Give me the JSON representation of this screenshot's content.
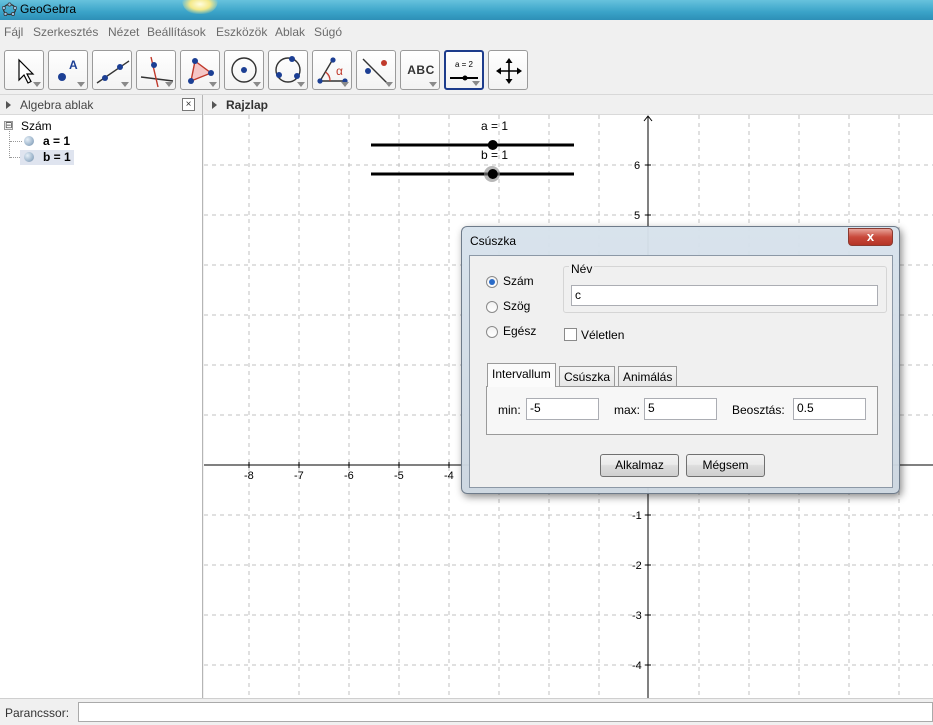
{
  "window": {
    "title": "GeoGebra"
  },
  "menu": [
    "Fájl",
    "Szerkesztés",
    "Nézet",
    "Beállítások",
    "Eszközök",
    "Ablak",
    "Súgó"
  ],
  "toolbar": {
    "tools": [
      {
        "icon": "move-arrow-icon"
      },
      {
        "icon": "new-point-icon",
        "label": "A"
      },
      {
        "icon": "line-through-two-points-icon"
      },
      {
        "icon": "perpendicular-line-icon"
      },
      {
        "icon": "polygon-icon"
      },
      {
        "icon": "circle-center-point-icon"
      },
      {
        "icon": "circle-three-points-icon"
      },
      {
        "icon": "angle-icon",
        "label": "α"
      },
      {
        "icon": "reflect-about-line-icon"
      },
      {
        "icon": "insert-text-icon",
        "label": "ABC"
      },
      {
        "icon": "slider-icon",
        "label": "a = 2"
      },
      {
        "icon": "move-graphics-view-icon"
      }
    ],
    "selected_index": 10
  },
  "algebra": {
    "title": "Algebra ablak",
    "close_label": "×",
    "group": "Szám",
    "toggle": "⊟",
    "objects": [
      "a = 1",
      "b = 1"
    ]
  },
  "graphics": {
    "title": "Rajzlap",
    "x_ticks": [
      "-8",
      "-7",
      "-6",
      "-5",
      "-4"
    ],
    "y_ticks": [
      "6",
      "5",
      "-1",
      "-2",
      "-3",
      "-4"
    ],
    "sliders": [
      {
        "label": "a = 1",
        "value": 1,
        "min": -5,
        "max": 5
      },
      {
        "label": "b = 1",
        "value": 1,
        "min": -5,
        "max": 5
      }
    ]
  },
  "dialog": {
    "title": "Csúszka",
    "close": "x",
    "types": [
      {
        "label": "Szám",
        "checked": true
      },
      {
        "label": "Szög",
        "checked": false
      },
      {
        "label": "Egész",
        "checked": false
      }
    ],
    "name_group_label": "Név",
    "name_value": "c",
    "random_label": "Véletlen",
    "tabs": [
      "Intervallum",
      "Csúszka",
      "Animálás"
    ],
    "active_tab": 0,
    "min_label": "min:",
    "min_value": "-5",
    "max_label": "max:",
    "max_value": "5",
    "step_label": "Beosztás:",
    "step_value": "0.5",
    "apply_label": "Alkalmaz",
    "cancel_label": "Mégsem"
  },
  "command_bar": {
    "label": "Parancssor:",
    "value": ""
  },
  "colors": {
    "titlebar": "#3aa3c8",
    "grid": "#c0c0c0",
    "selected_tool_border": "#1d3c8c",
    "dialog_close": "#c9493b"
  }
}
